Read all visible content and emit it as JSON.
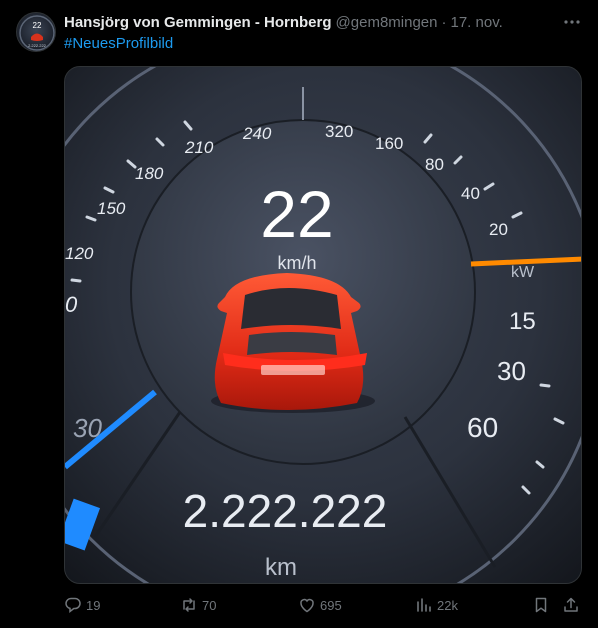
{
  "tweet": {
    "author_name": "Hansjörg von Gemmingen - Hornberg",
    "handle": "@gem8mingen",
    "separator": "·",
    "time": "17. nov.",
    "text": "#NeuesProfilbild",
    "avatar_text": {
      "speed": "22",
      "odometer": "2.222.222"
    }
  },
  "media": {
    "speed": "22",
    "speed_unit": "km/h",
    "odometer": "2.222.222",
    "odometer_unit": "km",
    "left_ticks": [
      "240",
      "210",
      "180",
      "150",
      "120",
      "0",
      "30"
    ],
    "right_ticks": [
      "320",
      "160",
      "80",
      "40",
      "20",
      "kW",
      "15",
      "30",
      "60"
    ]
  },
  "actions": {
    "replies": "19",
    "reposts": "70",
    "likes": "695",
    "views": "22k"
  },
  "colors": {
    "accent": "#1d9bf0",
    "muted": "#71767b",
    "background": "#000000",
    "car": "#e02a16",
    "gauge_orange": "#ff8a00",
    "gauge_blue": "#1f8bff"
  }
}
